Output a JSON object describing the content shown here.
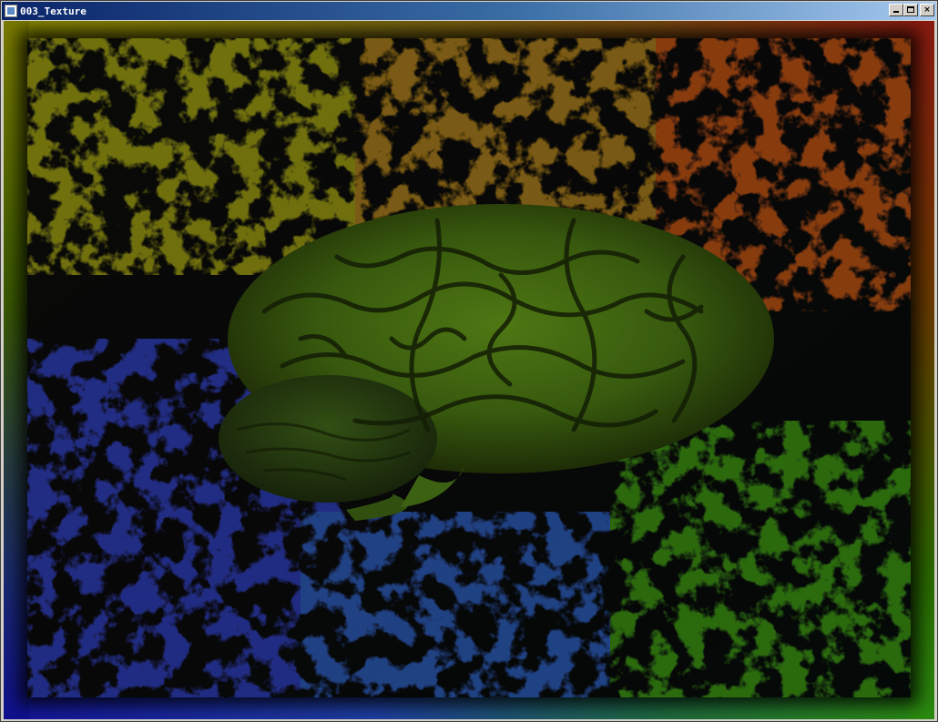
{
  "window": {
    "title": "003_Texture",
    "icon": "app-window-icon",
    "buttons": {
      "minimize": "minimize-icon",
      "maximize": "maximize-icon",
      "close": "×"
    }
  },
  "scene": {
    "description_icon": "brain-texture",
    "border_colors": {
      "top_left": "#8a8a00",
      "top_right": "#8a1a10",
      "bottom_left": "#101090",
      "bottom_right": "#2a8a10"
    },
    "brain_color": "#3f6a12",
    "background": "#020308"
  }
}
